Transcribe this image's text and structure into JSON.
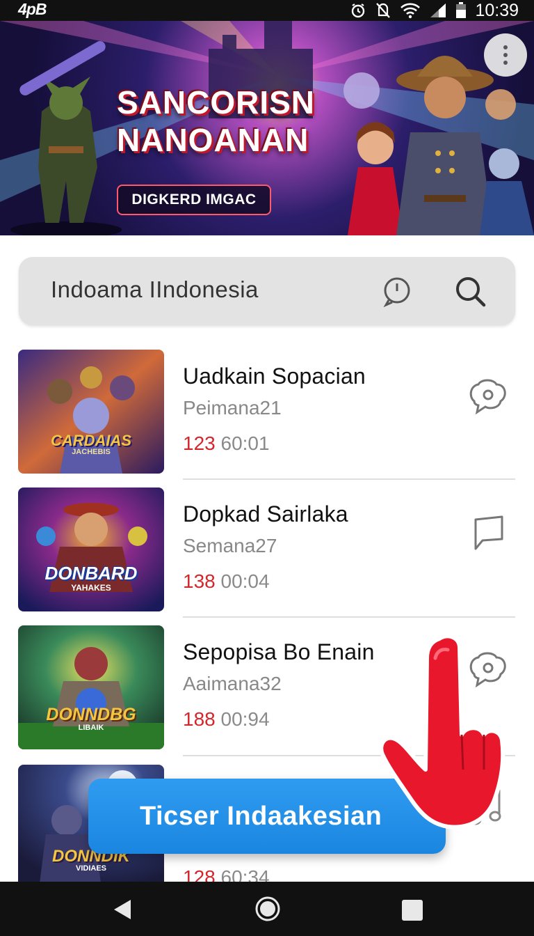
{
  "status_bar": {
    "left_label": "4pB",
    "time": "10:39",
    "icons": [
      "alarm-icon",
      "mute-icon",
      "wifi-icon",
      "signal-icon",
      "battery-icon"
    ]
  },
  "banner": {
    "title_line1": "SANCORISN",
    "title_line2": "NANOANAN",
    "badge": "DIGKERD IMGAC",
    "more_icon": "vertical-dots-icon"
  },
  "search": {
    "text": "Indoama IIndonesia",
    "icons": [
      "mic-icon",
      "search-icon"
    ]
  },
  "items": [
    {
      "title": "Uadkain Sopacian",
      "subtitle": "Peimana21",
      "count": "123",
      "time": "60:01",
      "thumb_text": "CARDAIAS",
      "thumb_sub": "JACHEBIS",
      "action_icon": "chat-bubble-icon"
    },
    {
      "title": "Dopkad Sairlaka",
      "subtitle": "Semana27",
      "count": "138",
      "time": "00:04",
      "thumb_text": "DONBARD",
      "thumb_sub": "YAHAKES",
      "action_icon": "message-icon"
    },
    {
      "title": "Sepopisa Bo Enain",
      "subtitle": "Aaimana32",
      "count": "188",
      "time": "00:94",
      "thumb_text": "DONNDBG",
      "thumb_sub": "LIBAIK",
      "action_icon": "chat-bubble-icon"
    },
    {
      "title": "",
      "subtitle": "",
      "count": "128",
      "time": "60:34",
      "thumb_text": "DONNDIK",
      "thumb_sub": "VIDIAES",
      "action_icon": "music-note-icon"
    }
  ],
  "cta": {
    "label": "Ticser Indaakesian"
  },
  "nav": {
    "icons": [
      "back-icon",
      "home-icon",
      "recents-icon"
    ]
  },
  "colors": {
    "accent_blue": "#1a86e0",
    "count_red": "#d3262d",
    "hand_red": "#e8172c"
  }
}
